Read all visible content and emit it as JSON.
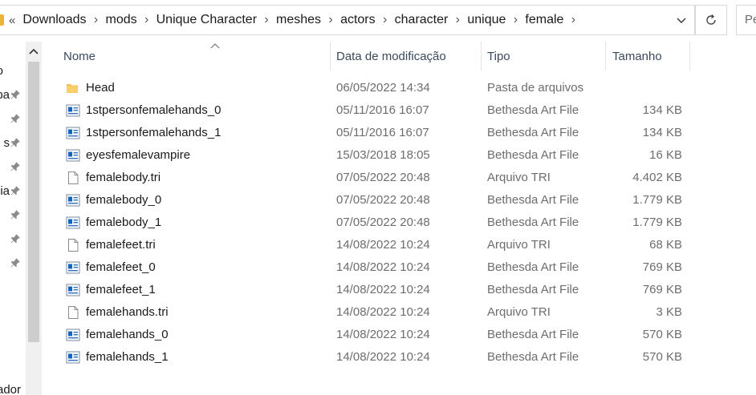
{
  "address": {
    "overflow": "«",
    "crumbs": [
      "Downloads",
      "mods",
      "Unique Character",
      "meshes",
      "actors",
      "character",
      "unique",
      "female"
    ],
    "separator": "›"
  },
  "search": {
    "placeholder": "Pe"
  },
  "nav": {
    "partial_labels": [
      "o",
      "pa",
      "s",
      "",
      "cia",
      "",
      "",
      ""
    ],
    "bottom_partial": "ador"
  },
  "columns": {
    "name": "Nome",
    "date": "Data de modificação",
    "type": "Tipo",
    "size": "Tamanho"
  },
  "files": [
    {
      "name": "Head",
      "date": "06/05/2022 14:34",
      "type": "Pasta de arquivos",
      "size": "",
      "icon": "folder-icon"
    },
    {
      "name": "1stpersonfemalehands_0",
      "date": "05/11/2016 16:07",
      "type": "Bethesda Art File",
      "size": "134 KB",
      "icon": "art-file-icon"
    },
    {
      "name": "1stpersonfemalehands_1",
      "date": "05/11/2016 16:07",
      "type": "Bethesda Art File",
      "size": "134 KB",
      "icon": "art-file-icon"
    },
    {
      "name": "eyesfemalevampire",
      "date": "15/03/2018 18:05",
      "type": "Bethesda Art File",
      "size": "16 KB",
      "icon": "art-file-icon"
    },
    {
      "name": "femalebody.tri",
      "date": "07/05/2022 20:48",
      "type": "Arquivo TRI",
      "size": "4.402 KB",
      "icon": "generic-file-icon"
    },
    {
      "name": "femalebody_0",
      "date": "07/05/2022 20:48",
      "type": "Bethesda Art File",
      "size": "1.779 KB",
      "icon": "art-file-icon"
    },
    {
      "name": "femalebody_1",
      "date": "07/05/2022 20:48",
      "type": "Bethesda Art File",
      "size": "1.779 KB",
      "icon": "art-file-icon"
    },
    {
      "name": "femalefeet.tri",
      "date": "14/08/2022 10:24",
      "type": "Arquivo TRI",
      "size": "68 KB",
      "icon": "generic-file-icon"
    },
    {
      "name": "femalefeet_0",
      "date": "14/08/2022 10:24",
      "type": "Bethesda Art File",
      "size": "769 KB",
      "icon": "art-file-icon"
    },
    {
      "name": "femalefeet_1",
      "date": "14/08/2022 10:24",
      "type": "Bethesda Art File",
      "size": "769 KB",
      "icon": "art-file-icon"
    },
    {
      "name": "femalehands.tri",
      "date": "14/08/2022 10:24",
      "type": "Arquivo TRI",
      "size": "3 KB",
      "icon": "generic-file-icon"
    },
    {
      "name": "femalehands_0",
      "date": "14/08/2022 10:24",
      "type": "Bethesda Art File",
      "size": "570 KB",
      "icon": "art-file-icon"
    },
    {
      "name": "femalehands_1",
      "date": "14/08/2022 10:24",
      "type": "Bethesda Art File",
      "size": "570 KB",
      "icon": "art-file-icon"
    }
  ],
  "colors": {
    "folder": "#f2c14e",
    "art_icon_blue": "#1565c0",
    "header_text": "#3a4a5c",
    "muted_text": "#6d6d6d"
  }
}
